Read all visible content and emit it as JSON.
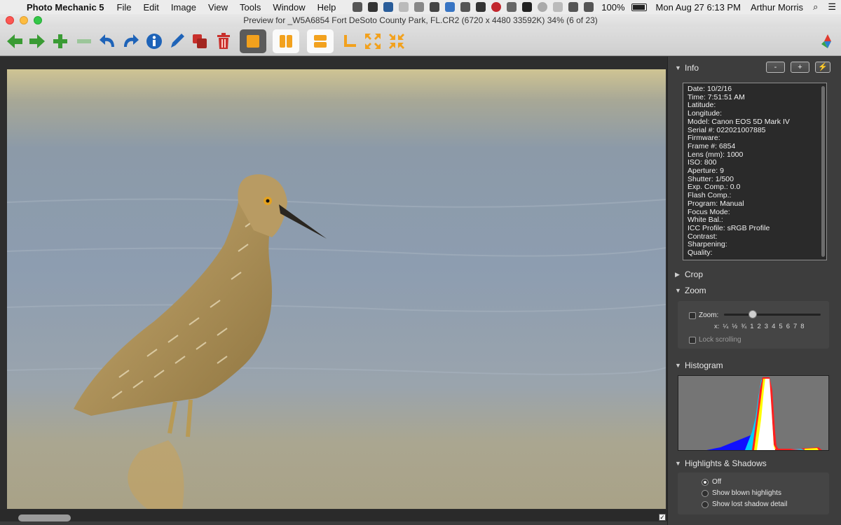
{
  "menubar": {
    "app_name": "Photo Mechanic 5",
    "menus": [
      "File",
      "Edit",
      "Image",
      "View",
      "Tools",
      "Window",
      "Help"
    ],
    "battery": "100%",
    "clock": "Mon Aug 27  6:13 PM",
    "user": "Arthur Morris"
  },
  "window": {
    "title": "Preview for _W5A6854  Fort DeSoto County Park, FL.CR2 (6720 x 4480 33592K) 34% (6 of 23)"
  },
  "colors": {
    "green_arrow": "#3a9b34",
    "blue_tool": "#1e63b8",
    "orange_tool": "#f2a11d",
    "red_tool": "#c9302c"
  },
  "icons": {
    "previous": "arrow-left-icon",
    "next": "arrow-right-icon",
    "tag": "plus-icon",
    "untag": "minus-icon",
    "rotate_left": "rotate-left-icon",
    "rotate_right": "rotate-right-icon",
    "info": "info-icon",
    "edit": "pen-icon",
    "copy": "duplicate-icon",
    "delete": "trash-icon",
    "view_single": "single-view-icon",
    "view_side": "side-by-side-icon",
    "view_stack": "stacked-icon",
    "crop": "crop-corner-icon",
    "zoom_in": "zoom-arrows-icon",
    "zoom_out": "zoom-out-arrows-icon",
    "app_logo": "photo-mechanic-logo-icon"
  },
  "panel": {
    "info": {
      "label": "Info",
      "minus": "-",
      "plus": "+",
      "lines": [
        "Date: 10/2/16",
        "Time: 7:51:51 AM",
        "Latitude:",
        "Longitude:",
        "Model: Canon EOS 5D Mark IV",
        "Serial #: 022021007885",
        "Firmware:",
        "Frame #: 6854",
        "Lens (mm): 1000",
        "ISO: 800",
        "Aperture: 9",
        "Shutter: 1/500",
        "Exp. Comp.: 0.0",
        "Flash Comp.:",
        "Program: Manual",
        "Focus Mode:",
        "White Bal.:",
        "ICC Profile: sRGB Profile",
        "Contrast:",
        "Sharpening:",
        "Quality:"
      ]
    },
    "crop": {
      "label": "Crop"
    },
    "zoom": {
      "label": "Zoom",
      "checkbox_label": "Zoom:",
      "slider_value": 0.3,
      "scale_prefix": "x:",
      "scale": [
        "¼",
        "½",
        "¾",
        "1",
        "2",
        "3",
        "4",
        "5",
        "6",
        "7",
        "8"
      ],
      "lock_label": "Lock scrolling"
    },
    "histogram": {
      "label": "Histogram"
    },
    "highlights": {
      "label": "Highlights & Shadows",
      "options": [
        "Off",
        "Show blown highlights",
        "Show lost shadow detail"
      ],
      "selected": 0
    }
  }
}
